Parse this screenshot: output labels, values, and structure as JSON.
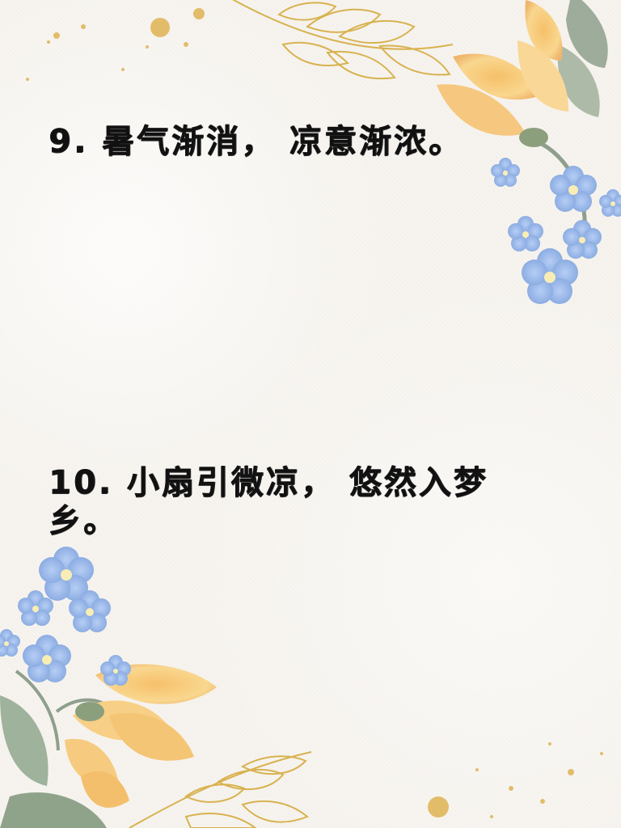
{
  "quotes": [
    {
      "text": "9. 暑气渐消， 凉意渐浓。"
    },
    {
      "text": "10. 小扇引微凉， 悠然入梦乡。"
    }
  ],
  "colors": {
    "background": "#f7f4ef",
    "text": "#111111",
    "gold": "#d9b24f",
    "yellow_petal": "#f8d38c",
    "blue_petal": "#8fb1e6",
    "leaf": "#9eb09a"
  },
  "decorations": [
    "gold-leaf-branch-icon",
    "yellow-flower-icon",
    "blue-forget-me-not-icon",
    "green-leaf-icon",
    "gold-speckle-icon"
  ]
}
